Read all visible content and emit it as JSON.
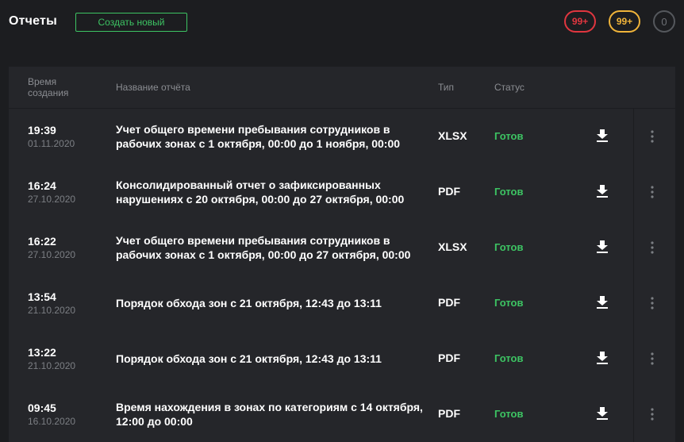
{
  "header": {
    "title": "Отчеты",
    "create_label": "Создать новый",
    "badges": [
      {
        "text": "99+",
        "color": "#e0363f"
      },
      {
        "text": "99+",
        "color": "#f0b43a"
      },
      {
        "text": "0",
        "color": "#6d7075"
      }
    ]
  },
  "table": {
    "columns": {
      "time": "Время создания",
      "name": "Название отчёта",
      "type": "Тип",
      "status": "Статус"
    },
    "rows": [
      {
        "time": "19:39",
        "date": "01.11.2020",
        "name": "Учет общего времени пребывания сотрудников в рабочих зонах с 1 октября, 00:00 до 1 ноября, 00:00",
        "type": "XLSX",
        "status": "Готов"
      },
      {
        "time": "16:24",
        "date": "27.10.2020",
        "name": "Консолидированный отчет о зафиксированных нарушениях с 20 октября, 00:00 до 27 октября, 00:00",
        "type": "PDF",
        "status": "Готов"
      },
      {
        "time": "16:22",
        "date": "27.10.2020",
        "name": "Учет общего времени пребывания сотрудников в рабочих зонах с 1 октября, 00:00 до 27 октября, 00:00",
        "type": "XLSX",
        "status": "Готов"
      },
      {
        "time": "13:54",
        "date": "21.10.2020",
        "name": "Порядок обхода зон с 21 октября, 12:43 до 13:11",
        "type": "PDF",
        "status": "Готов"
      },
      {
        "time": "13:22",
        "date": "21.10.2020",
        "name": "Порядок обхода зон с 21 октября, 12:43 до 13:11",
        "type": "PDF",
        "status": "Готов"
      },
      {
        "time": "09:45",
        "date": "16.10.2020",
        "name": "Время нахождения в зонах по категориям с 14 октября, 12:00 до 00:00",
        "type": "PDF",
        "status": "Готов"
      }
    ]
  },
  "icons": {
    "download": "download-icon",
    "menu": "more-vertical-icon"
  },
  "colors": {
    "accent": "#3dc463",
    "background": "#1c1d20",
    "panel": "#25262a"
  }
}
